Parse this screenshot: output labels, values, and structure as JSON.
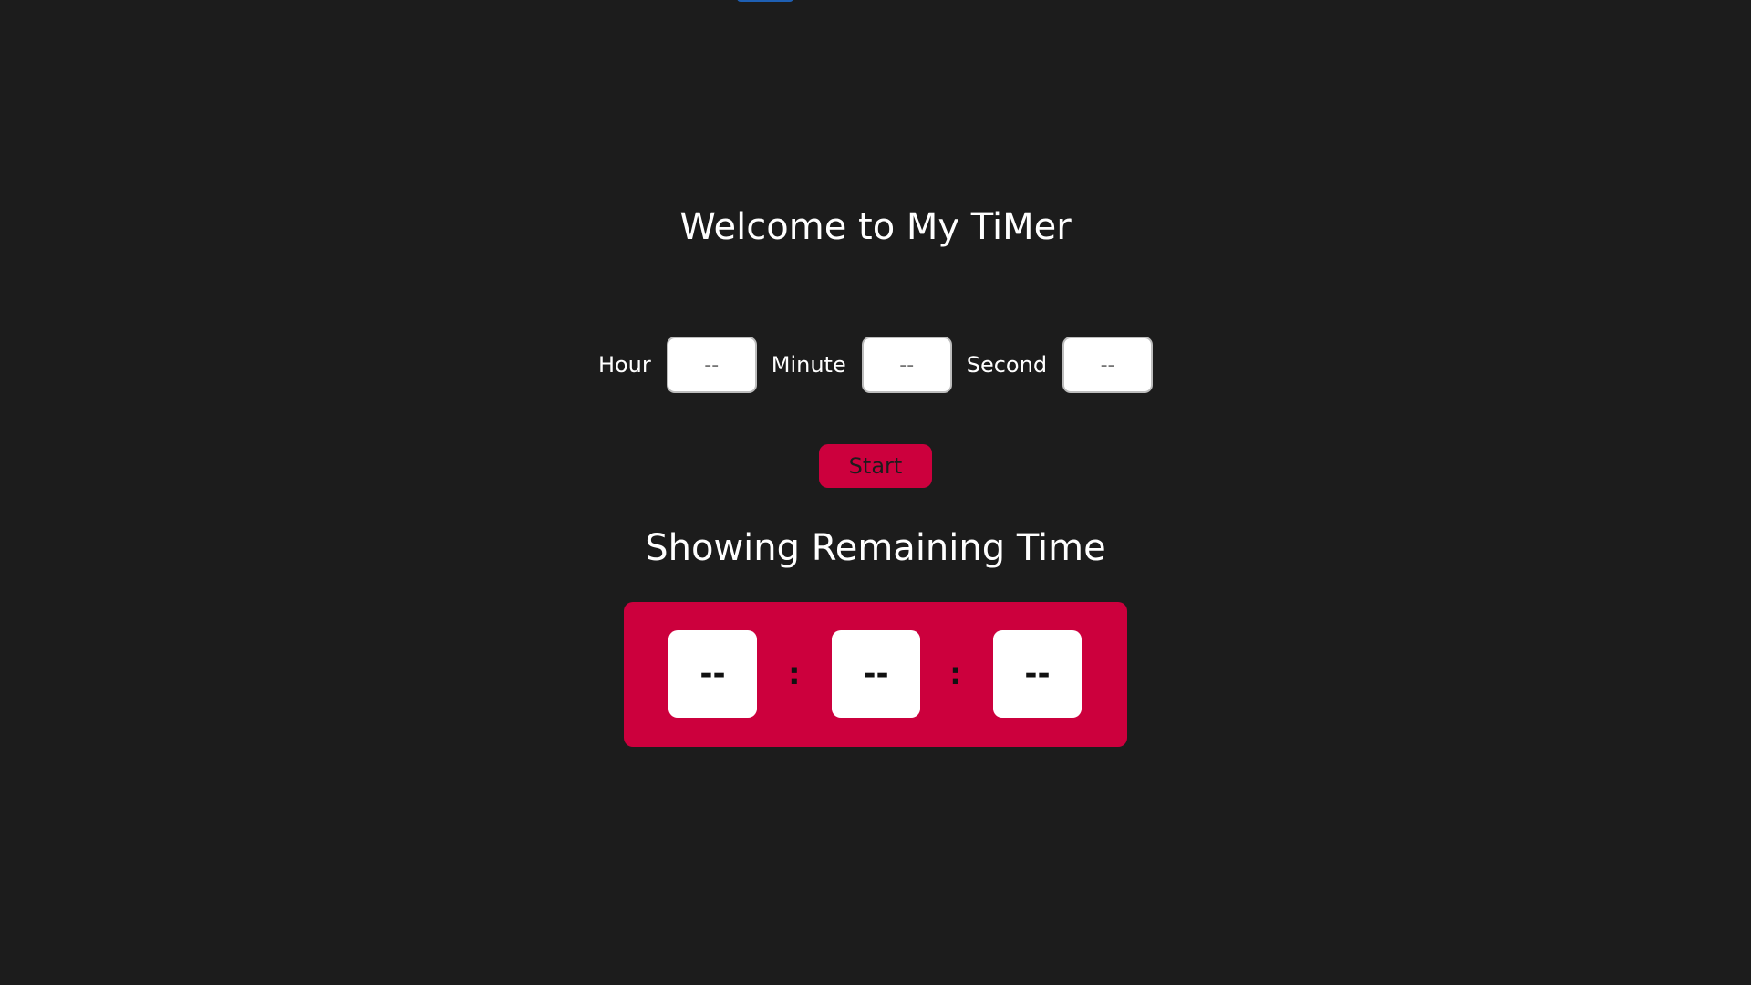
{
  "header": {
    "title": "Welcome to My TiMer"
  },
  "inputs": {
    "hour_label": "Hour",
    "hour_placeholder": "--",
    "minute_label": "Minute",
    "minute_placeholder": "--",
    "second_label": "Second",
    "second_placeholder": "--"
  },
  "controls": {
    "start_label": "Start"
  },
  "display": {
    "heading": "Showing Remaining Time",
    "hours": "--",
    "minutes": "--",
    "seconds": "--",
    "separator": ":"
  },
  "colors": {
    "background": "#1c1c1c",
    "accent": "#cc003d",
    "text": "#ffffff"
  }
}
